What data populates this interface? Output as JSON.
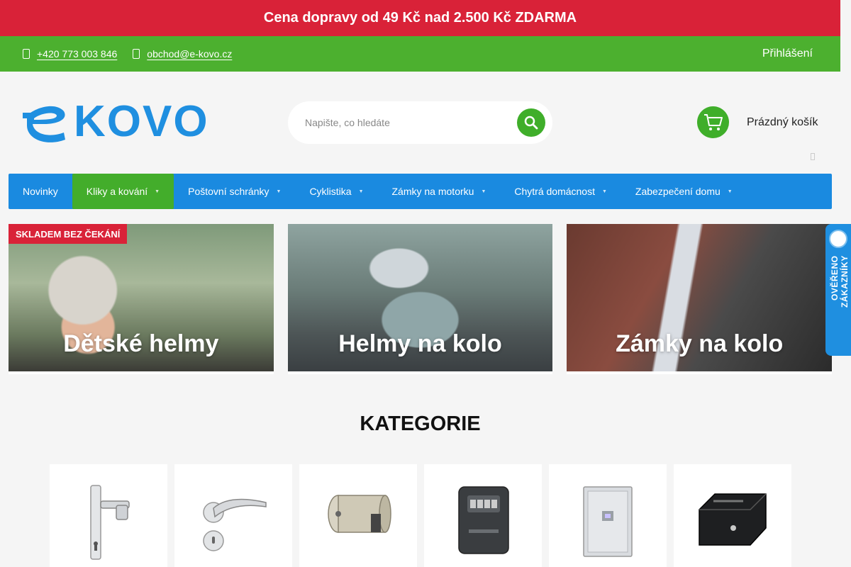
{
  "promo": {
    "text": "Cena dopravy od 49 Kč nad 2.500 Kč ZDARMA"
  },
  "contact": {
    "phone": "+420 773 003 846",
    "email": "obchod@e-kovo.cz",
    "login": "Přihlášení"
  },
  "header": {
    "logo_text": "KOVO",
    "search_placeholder": "Napište, co hledáte",
    "cart_label": "Prázdný košík"
  },
  "nav": {
    "items": [
      {
        "label": "Novinky"
      },
      {
        "label": "Kliky a kování"
      },
      {
        "label": "Poštovní schránky"
      },
      {
        "label": "Cyklistika"
      },
      {
        "label": "Zámky na motorku"
      },
      {
        "label": "Chytrá domácnost"
      },
      {
        "label": "Zabezpečení domu"
      }
    ],
    "active_index": 1
  },
  "banners": [
    {
      "title": "Dětské helmy",
      "badge": "SKLADEM BEZ ČEKÁNÍ"
    },
    {
      "title": "Helmy na kolo"
    },
    {
      "title": "Zámky na kolo"
    }
  ],
  "verified": {
    "text": "OVĚŘENO ZÁKAZNÍKY"
  },
  "categories_section": {
    "title": "KATEGORIE"
  },
  "colors": {
    "promo_red": "#d92238",
    "contact_green": "#4cb02f",
    "nav_blue": "#1a8ae0",
    "active_green": "#43ad2b",
    "brand_blue": "#1f8fe0"
  }
}
